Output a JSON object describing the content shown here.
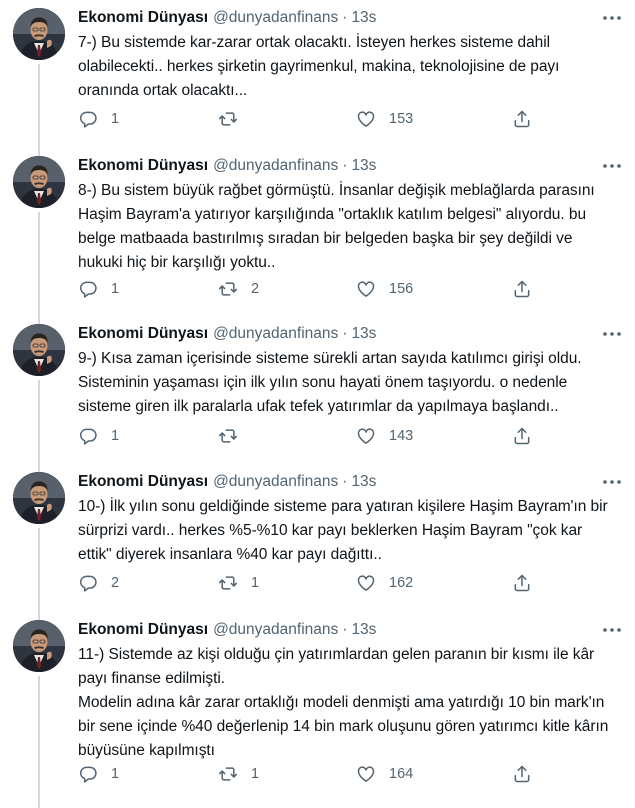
{
  "author": {
    "name": "Ekonomi Dünyası",
    "handle": "@dunyadanfinans",
    "time": "13s"
  },
  "icons": {
    "more": "more-dots-icon",
    "reply": "reply-icon",
    "retweet": "retweet-icon",
    "like": "heart-icon",
    "share": "share-icon"
  },
  "colors": {
    "text": "#0f1419",
    "muted": "#536471",
    "thread_line": "#cfd9de"
  },
  "tweets": [
    {
      "text": "7-) Bu sistemde kar-zarar ortak olacaktı. İsteyen herkes sisteme dahil\nolabilecekti.. herkes şirketin gayrimenkul, makina, teknolojisine de payı\noranında ortak olacaktı...",
      "replies": "1",
      "retweets": "",
      "likes": "153"
    },
    {
      "text": "8-) Bu sistem büyük rağbet görmüştü. İnsanlar değişik meblağlarda parasını\nHaşim Bayram'a yatırıyor karşılığında \"ortaklık katılım belgesi\" alıyordu. bu\nbelge matbaada bastırılmış sıradan bir belgeden başka bir şey değildi ve\nhukuki hiç bir karşılığı yoktu..",
      "replies": "1",
      "retweets": "2",
      "likes": "156"
    },
    {
      "text": "9-) Kısa zaman içerisinde sisteme sürekli artan sayıda katılımcı girişi oldu.\nSisteminin yaşaması için ilk yılın sonu hayati önem taşıyordu. o nedenle\nsisteme giren ilk paralarla ufak tefek yatırımlar da yapılmaya başlandı..",
      "replies": "1",
      "retweets": "",
      "likes": "143"
    },
    {
      "text": "10-) İlk yılın sonu geldiğinde sisteme para yatıran kişilere Haşim Bayram'ın bir\nsürprizi vardı.. herkes %5-%10 kar payı beklerken Haşim Bayram \"çok kar\nettik\" diyerek insanlara %40 kar payı dağıttı..",
      "replies": "2",
      "retweets": "1",
      "likes": "162"
    },
    {
      "text": "11-) Sistemde az kişi olduğu çin yatırımlardan gelen paranın bir kısmı ile kâr\npayı finanse edilmişti.\nModelin adına kâr zarar ortaklığı modeli denmişti ama yatırdığı 10 bin mark'ın\nbir sene içinde %40 değerlenip 14 bin mark oluşunu gören yatırımcı kitle kârın\nbüyüsüne kapılmıştı",
      "replies": "1",
      "retweets": "1",
      "likes": "164"
    }
  ]
}
